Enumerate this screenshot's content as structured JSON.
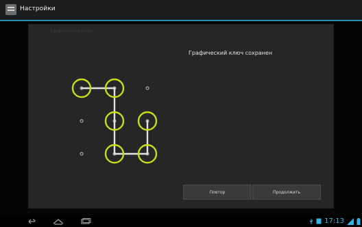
{
  "action_bar": {
    "title": "Настройки",
    "icon": "settings-app-icon"
  },
  "dialog": {
    "ghost_title": "Графический ключ",
    "header": "Графический ключ сохранен",
    "buttons": {
      "retry": "Повтор",
      "continue": "Продолжить"
    },
    "pattern": {
      "grid_size": 3,
      "selected_nodes": [
        0,
        1,
        4,
        7,
        8,
        5
      ],
      "accent": "#c9de1a"
    }
  },
  "system_bar": {
    "time": "17:13",
    "icons": [
      "back-icon",
      "home-icon",
      "recent-apps-icon",
      "usb-icon",
      "sd-card-icon",
      "wifi-icon",
      "battery-icon"
    ]
  },
  "colors": {
    "accent_line": "#2a8fb3",
    "clock": "#35b5e5",
    "pattern_ring": "#c9de1a"
  }
}
